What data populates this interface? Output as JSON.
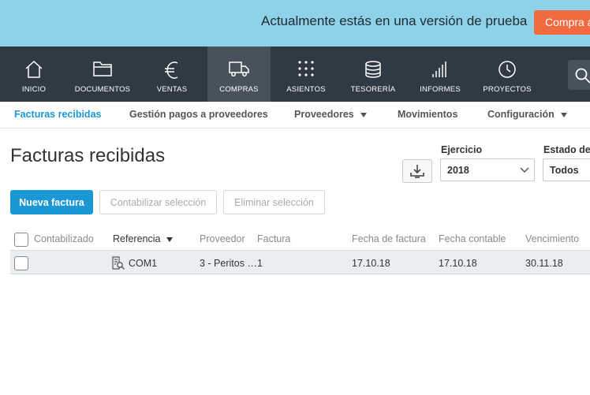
{
  "banner": {
    "message": "Actualmente estás en una versión de prueba",
    "buy_label": "Compra ahora"
  },
  "nav": {
    "items": [
      {
        "label": "INICIO",
        "icon": "home-icon"
      },
      {
        "label": "DOCUMENTOS",
        "icon": "folder-icon"
      },
      {
        "label": "VENTAS",
        "icon": "euro-icon"
      },
      {
        "label": "COMPRAS",
        "icon": "truck-icon",
        "active": true
      },
      {
        "label": "ASIENTOS",
        "icon": "grid-dots-icon"
      },
      {
        "label": "TESORERÍA",
        "icon": "coins-icon"
      },
      {
        "label": "INFORMES",
        "icon": "bar-chart-icon"
      },
      {
        "label": "PROYECTOS",
        "icon": "clock-icon"
      }
    ],
    "search_icon": "search-icon"
  },
  "subnav": {
    "items": [
      {
        "label": "Facturas recibidas",
        "active": true
      },
      {
        "label": "Gestión pagos a proveedores"
      },
      {
        "label": "Proveedores",
        "dropdown": true
      },
      {
        "label": "Movimientos"
      },
      {
        "label": "Configuración",
        "dropdown": true
      }
    ]
  },
  "page": {
    "title": "Facturas recibidas",
    "exercise_label": "Ejercicio",
    "exercise_value": "2018",
    "status_label": "Estado del",
    "status_value": "Todos"
  },
  "actions": {
    "new_invoice": "Nueva factura",
    "post_selection": "Contabilizar selección",
    "delete_selection": "Eliminar selección"
  },
  "table": {
    "columns": [
      "Contabilizado",
      "Referencia",
      "Proveedor",
      "Factura",
      "Fecha de factura",
      "Fecha contable",
      "Vencimiento"
    ],
    "sorted_column": "Referencia",
    "rows": [
      {
        "reference": "COM1",
        "supplier": "3 - Peritos …",
        "invoice": "1",
        "invoice_date": "17.10.18",
        "accounting_date": "17.10.18",
        "due_date": "30.11.18"
      }
    ]
  },
  "colors": {
    "banner_bg": "#8ed2ea",
    "buy_button": "#f26a3f",
    "nav_bg": "#2f3a45",
    "nav_active": "#47525c",
    "accent": "#1a97d4"
  }
}
